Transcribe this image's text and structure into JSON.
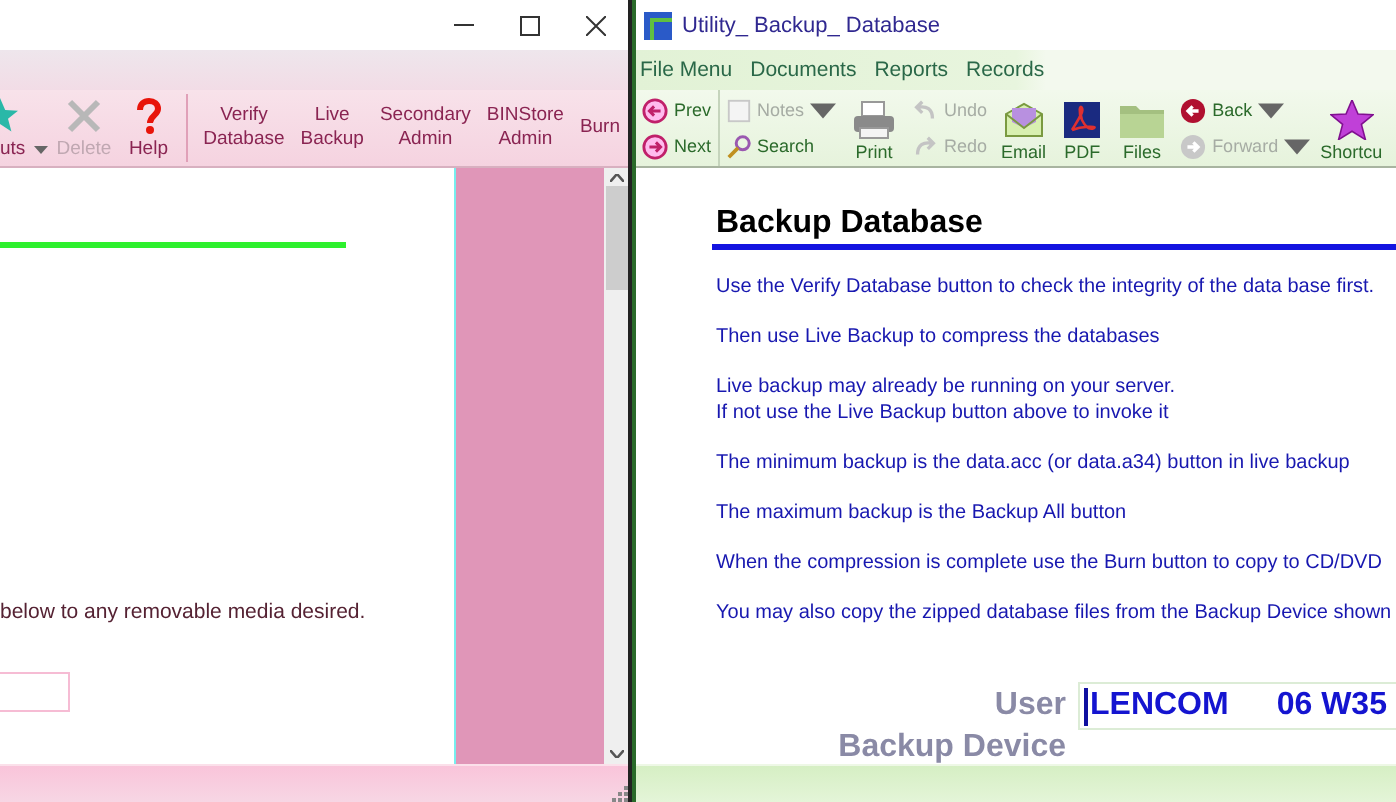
{
  "left_window": {
    "toolbar": [
      {
        "kind": "icon",
        "label": "uts",
        "dropdown": true,
        "disabled": false
      },
      {
        "kind": "icon",
        "label": "Delete",
        "dropdown": false,
        "disabled": true
      },
      {
        "kind": "icon",
        "label": "Help",
        "dropdown": false,
        "disabled": false
      },
      {
        "kind": "text",
        "label": "Verify Database",
        "disabled": false
      },
      {
        "kind": "text",
        "label": "Live Backup",
        "disabled": false
      },
      {
        "kind": "text",
        "label": "Secondary Admin",
        "disabled": false
      },
      {
        "kind": "text",
        "label": "BINStore Admin",
        "disabled": false
      },
      {
        "kind": "text",
        "label": "Burn",
        "disabled": false
      }
    ],
    "content": {
      "note": "below to any removable media desired."
    }
  },
  "right_window": {
    "title": "Utility_ Backup_ Database",
    "menu": [
      "File Menu",
      "Documents",
      "Reports",
      "Records"
    ],
    "toolbar": [
      {
        "kind": "stack",
        "items": [
          {
            "label": "Prev",
            "disabled": false,
            "dropdown": false
          },
          {
            "label": "Next",
            "disabled": false,
            "dropdown": false
          }
        ]
      },
      {
        "kind": "stack",
        "items": [
          {
            "label": "Notes",
            "disabled": true,
            "dropdown": true
          },
          {
            "label": "Search",
            "disabled": false,
            "dropdown": false
          }
        ]
      },
      {
        "kind": "big",
        "label": "Print"
      },
      {
        "kind": "stack",
        "items": [
          {
            "label": "Undo",
            "disabled": true,
            "dropdown": false
          },
          {
            "label": "Redo",
            "disabled": true,
            "dropdown": false
          }
        ]
      },
      {
        "kind": "big",
        "label": "Email"
      },
      {
        "kind": "big",
        "label": "PDF"
      },
      {
        "kind": "big",
        "label": "Files"
      },
      {
        "kind": "stack",
        "items": [
          {
            "label": "Back",
            "disabled": false,
            "dropdown": true
          },
          {
            "label": "Forward",
            "disabled": true,
            "dropdown": true
          }
        ]
      },
      {
        "kind": "big",
        "label": "Shortcu"
      }
    ],
    "content": {
      "heading": "Backup Database",
      "paragraphs": [
        [
          "Use the Verify Database button to check the integrity of the data base first."
        ],
        [
          "Then use Live Backup to compress the databases"
        ],
        [
          "Live backup may already be running on your server.",
          "If not use the Live Backup button above to invoke it"
        ],
        [
          "The minimum backup is the data.acc (or data.a34) button in live backup"
        ],
        [
          "The maximum backup is the Backup All button"
        ],
        [
          "When the compression is complete use the Burn button to copy to CD/DVD"
        ],
        [
          "You may also copy the zipped database files from the Backup Device shown"
        ]
      ],
      "user_label": "User",
      "user_field": {
        "value": "LENCOM",
        "code": "06 W35"
      },
      "device_label": "Backup Device"
    }
  }
}
